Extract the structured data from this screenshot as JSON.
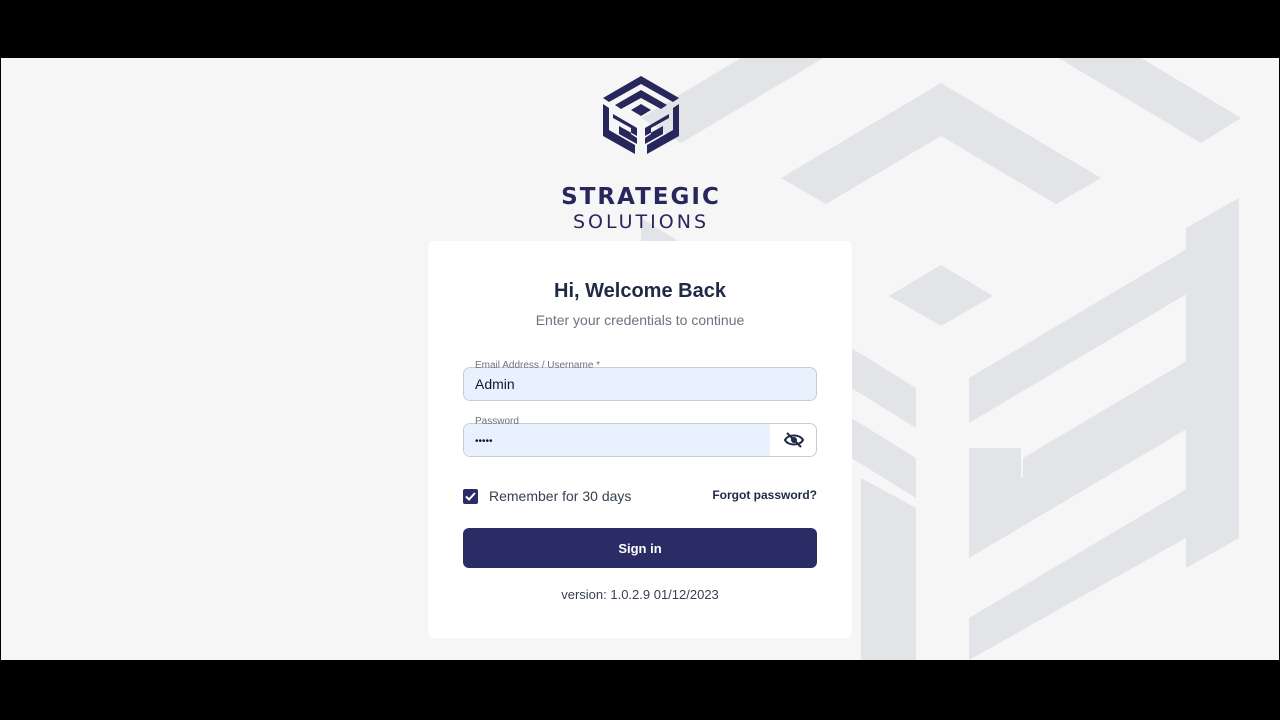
{
  "brand": {
    "name_line1": "STRATEGIC",
    "name_line2": "SOLUTIONS",
    "color": "#27275c"
  },
  "login": {
    "title": "Hi, Welcome Back",
    "subtitle": "Enter your credentials to continue",
    "email": {
      "label": "Email Address / Username *",
      "value": "Admin"
    },
    "password": {
      "label": "Password",
      "value": "•••••",
      "toggle_icon": "eye-off-icon"
    },
    "remember": {
      "label": "Remember for 30 days",
      "checked": true
    },
    "forgot_label": "Forgot password?",
    "signin_label": "Sign in",
    "version": "version: 1.0.2.9 01/12/2023"
  },
  "colors": {
    "primary": "#2a2c66",
    "background": "#f6f6f7",
    "input_fill": "#e9f0fe"
  }
}
